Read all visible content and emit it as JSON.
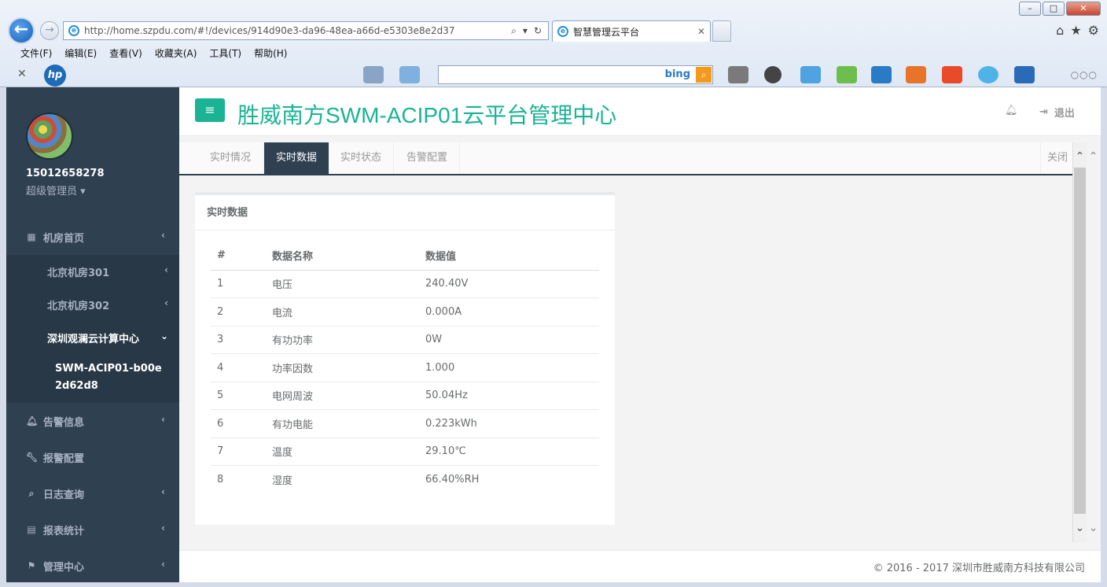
{
  "browser": {
    "url": "http://home.szpdu.com/#!/devices/914d90e3-da96-48ea-a66d-e5303e8e2d37",
    "tab_title": "智慧管理云平台",
    "menu": [
      "文件(F)",
      "编辑(E)",
      "查看(V)",
      "收藏夹(A)",
      "工具(T)",
      "帮助(H)"
    ],
    "search_engine": "bing"
  },
  "sidebar": {
    "username": "15012658278",
    "role": "超级管理员",
    "nav": [
      {
        "label": "机房首页",
        "icon": "grid-icon"
      },
      {
        "label": "告警信息",
        "icon": "bell-icon"
      },
      {
        "label": "报警配置",
        "icon": "wrench-icon"
      },
      {
        "label": "日志查询",
        "icon": "search-icon"
      },
      {
        "label": "报表统计",
        "icon": "table-icon"
      },
      {
        "label": "管理中心",
        "icon": "flag-icon"
      }
    ],
    "sub": [
      {
        "label": "北京机房301"
      },
      {
        "label": "北京机房302"
      },
      {
        "label": "深圳观澜云计算中心"
      }
    ],
    "device": "SWM-ACIP01-b00e2d62d8"
  },
  "header": {
    "title": "胜威南方SWM-ACIP01云平台管理中心",
    "logout": "退出"
  },
  "tabs": {
    "items": [
      "实时情况",
      "实时数据",
      "实时状态",
      "告警配置"
    ],
    "active": "实时数据",
    "close": "关闭"
  },
  "card": {
    "title": "实时数据",
    "headers": [
      "#",
      "数据名称",
      "数据值"
    ],
    "rows": [
      {
        "idx": "1",
        "name": "电压",
        "value": "240.40V"
      },
      {
        "idx": "2",
        "name": "电流",
        "value": "0.000A"
      },
      {
        "idx": "3",
        "name": "有功功率",
        "value": "0W"
      },
      {
        "idx": "4",
        "name": "功率因数",
        "value": "1.000"
      },
      {
        "idx": "5",
        "name": "电网周波",
        "value": "50.04Hz"
      },
      {
        "idx": "6",
        "name": "有功电能",
        "value": "0.223kWh"
      },
      {
        "idx": "7",
        "name": "温度",
        "value": "29.10℃"
      },
      {
        "idx": "8",
        "name": "湿度",
        "value": "66.40%RH"
      }
    ]
  },
  "footer": {
    "text": "© 2016 - 2017 深圳市胜威南方科技有限公司"
  },
  "colors": {
    "accent": "#1ab394",
    "sidebar": "#2f4050"
  }
}
